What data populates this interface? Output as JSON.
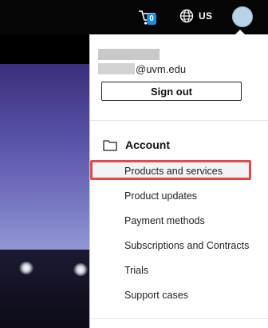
{
  "header": {
    "cart_count": "0",
    "region": "US"
  },
  "account_menu": {
    "email_domain": "@uvm.edu",
    "sign_out_label": "Sign out",
    "section_title": "Account",
    "items": [
      {
        "label": "Products and services",
        "highlighted": true
      },
      {
        "label": "Product updates"
      },
      {
        "label": "Payment methods"
      },
      {
        "label": "Subscriptions and Contracts"
      },
      {
        "label": "Trials"
      },
      {
        "label": "Support cases"
      }
    ]
  },
  "colors": {
    "accent_badge": "#1e8ae2",
    "highlight_border": "#e24a4a"
  }
}
